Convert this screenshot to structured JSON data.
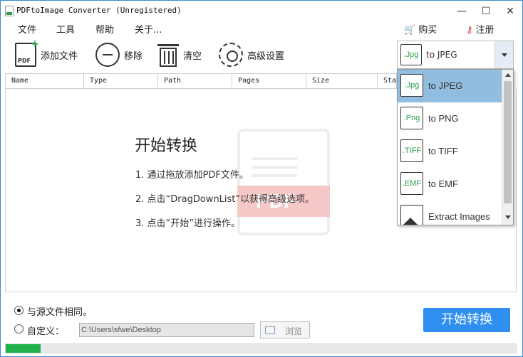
{
  "window": {
    "title": "PDFtoImage Converter (Unregistered)",
    "minimize": "—",
    "maximize": "☐",
    "close": "✕"
  },
  "menu": {
    "items": [
      "文件",
      "工具",
      "帮助",
      "关于..."
    ],
    "buy_label": "购买",
    "register_label": "注册",
    "buy_icon": "cart-icon",
    "register_icon": "key-icon"
  },
  "toolbar": {
    "add_label": "添加文件",
    "remove_label": "移除",
    "clear_label": "清空",
    "settings_label": "高级设置"
  },
  "format": {
    "selected_badge": ".Jpg",
    "selected_label": "to JPEG",
    "options": [
      {
        "badge": ".Jpg",
        "label": "to JPEG"
      },
      {
        "badge": ".Png",
        "label": "to PNG"
      },
      {
        "badge": ".TIFF",
        "label": "to TIFF"
      },
      {
        "badge": ".EMF",
        "label": "to EMF"
      },
      {
        "badge": "",
        "label": "Extract Images"
      }
    ]
  },
  "table": {
    "columns": [
      "Name",
      "Type",
      "Path",
      "Pages",
      "Size",
      "Stat"
    ]
  },
  "empty_state": {
    "title": "开始转换",
    "steps": [
      "1. 通过拖放添加PDF文件。",
      "2. 点击“DragDownList”以获得高级选项。",
      "3. 点击“开始”进行操作。"
    ],
    "watermark": "PDF"
  },
  "output": {
    "same_as_source_label": "与源文件相同。",
    "custom_label": "自定义：",
    "path_value": "C:\\Users\\sfwe\\Desktop",
    "browse_label": "浏览",
    "start_label": "开始转换"
  },
  "progress": {
    "fraction": 0.068
  },
  "colors": {
    "accent": "#2f8ff0",
    "progress": "#21b14b",
    "selected_row": "#91bde0",
    "badge_text": "#2a9d4b"
  }
}
